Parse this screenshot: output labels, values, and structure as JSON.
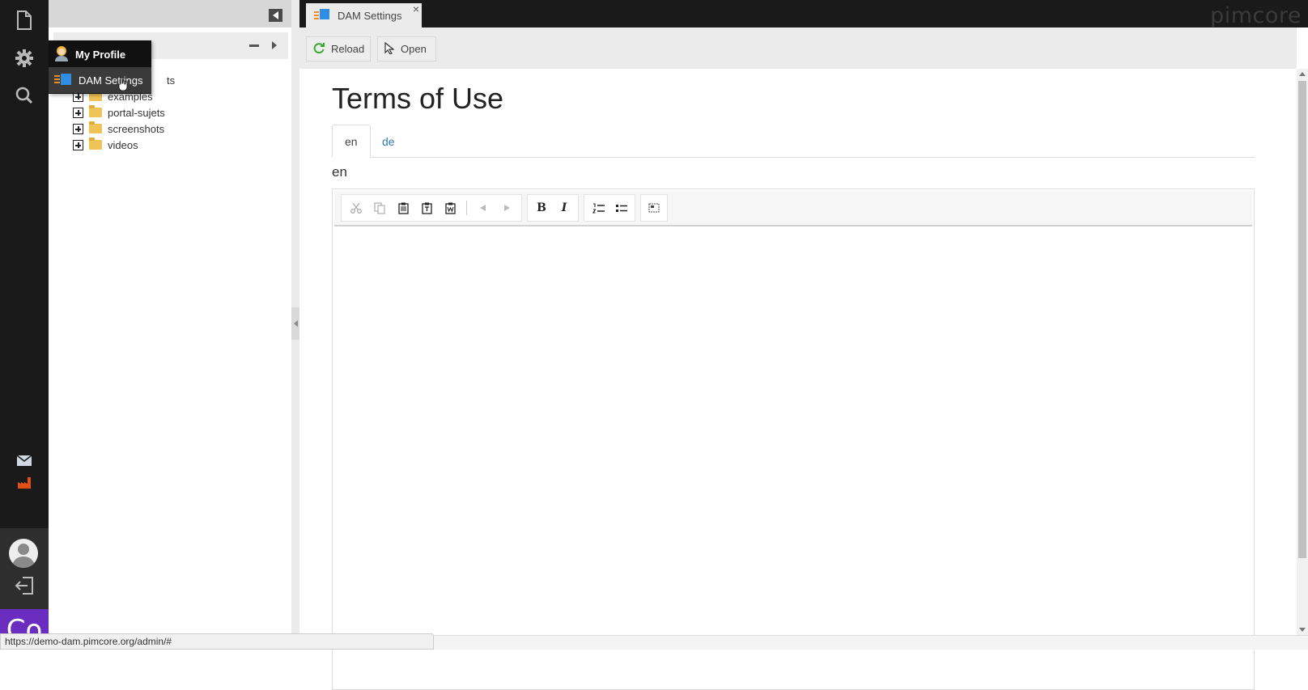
{
  "rail": {
    "icons": [
      "document-icon",
      "gear-icon",
      "search-icon",
      "mail-icon",
      "factory-icon",
      "user-avatar-icon",
      "logout-icon"
    ],
    "brand_text": "Co"
  },
  "context_menu": {
    "items": [
      {
        "label": "My Profile",
        "icon": "user-profile-icon"
      },
      {
        "label": "DAM Settings",
        "icon": "dam-settings-icon"
      }
    ]
  },
  "tree": {
    "first_item_partial": "ts",
    "items": [
      {
        "label": "examples"
      },
      {
        "label": "portal-sujets"
      },
      {
        "label": "screenshots"
      },
      {
        "label": "videos"
      }
    ]
  },
  "tabs": [
    {
      "label": "DAM Settings",
      "close": "×"
    }
  ],
  "logo": "pimcore",
  "toolbar": {
    "reload_label": "Reload",
    "open_label": "Open"
  },
  "content": {
    "title": "Terms of Use",
    "lang_tabs": [
      "en",
      "de"
    ],
    "active_lang": "en",
    "field_label": "en"
  },
  "editor_toolbar": {
    "buttons": [
      "cut-icon",
      "copy-icon",
      "paste-icon",
      "paste-text-icon",
      "paste-word-icon",
      "undo-icon",
      "redo-icon",
      "bold-icon",
      "italic-icon",
      "numbered-list-icon",
      "bulleted-list-icon",
      "source-icon"
    ],
    "bold_glyph": "B",
    "italic_glyph": "I"
  },
  "status_url": "https://demo-dam.pimcore.org/admin/#",
  "colors": {
    "rail": "#1a1a1a",
    "brand": "#6b2dbf",
    "link": "#337ab7",
    "folder": "#f0c356"
  }
}
